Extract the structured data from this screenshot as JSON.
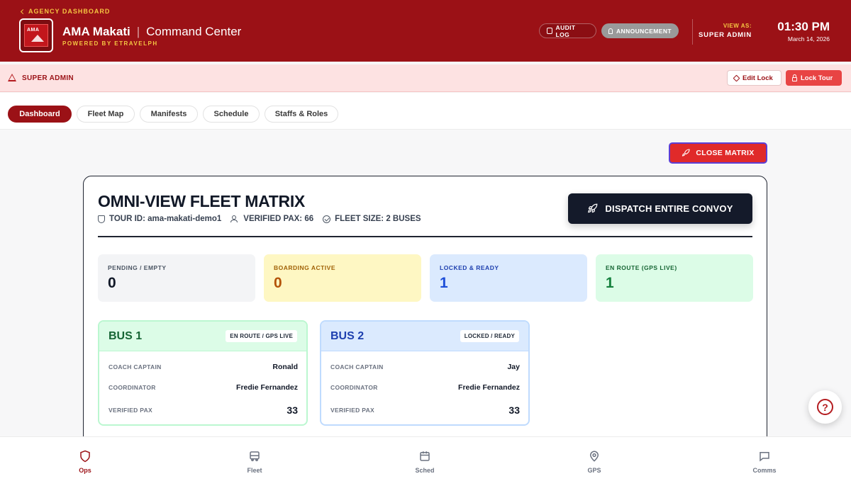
{
  "header": {
    "back_label": "AGENCY DASHBOARD",
    "brand": "AMA Makati",
    "separator": "|",
    "subtitle": "Command Center",
    "powered_by": "POWERED BY ETRAVELPH",
    "logo_text": "AMA",
    "audit_label": "AUDIT LOG",
    "announcement_label": "ANNOUNCEMENT",
    "view_as_label": "VIEW AS:",
    "view_as_value": "SUPER ADMIN",
    "time": "01:30 PM",
    "date": "March 14, 2026",
    "colors": {
      "bg": "#9b1116",
      "accent": "#f5c542"
    }
  },
  "admin_bar": {
    "label": "SUPER ADMIN",
    "edit_lock_label": "Edit Lock",
    "lock_tour_label": "Lock Tour"
  },
  "tabs": [
    {
      "label": "Dashboard",
      "active": true
    },
    {
      "label": "Fleet Map",
      "active": false
    },
    {
      "label": "Manifests",
      "active": false
    },
    {
      "label": "Schedule",
      "active": false
    },
    {
      "label": "Staffs & Roles",
      "active": false
    }
  ],
  "close_matrix_label": "CLOSE MATRIX",
  "matrix": {
    "title": "OMNI-VIEW FLEET MATRIX",
    "tour_id": "TOUR ID: ama-makati-demo1",
    "verified_pax": "VERIFIED PAX: 66",
    "fleet_size": "FLEET SIZE: 2 BUSES",
    "dispatch_label": "DISPATCH ENTIRE CONVOY",
    "stats": [
      {
        "label": "PENDING / EMPTY",
        "value": "0"
      },
      {
        "label": "BOARDING ACTIVE",
        "value": "0"
      },
      {
        "label": "LOCKED & READY",
        "value": "1"
      },
      {
        "label": "EN ROUTE (GPS LIVE)",
        "value": "1"
      }
    ],
    "buses": [
      {
        "name": "BUS 1",
        "status": "EN ROUTE / GPS LIVE",
        "rows": [
          {
            "key": "COACH CAPTAIN",
            "value": "Ronald"
          },
          {
            "key": "COORDINATOR",
            "value": "Fredie Fernandez"
          },
          {
            "key": "VERIFIED PAX",
            "value": "33"
          }
        ]
      },
      {
        "name": "BUS 2",
        "status": "LOCKED / READY",
        "rows": [
          {
            "key": "COACH CAPTAIN",
            "value": "Jay"
          },
          {
            "key": "COORDINATOR",
            "value": "Fredie Fernandez"
          },
          {
            "key": "VERIFIED PAX",
            "value": "33"
          }
        ]
      }
    ]
  },
  "help_glyph": "?",
  "bottom_nav": [
    {
      "label": "Ops",
      "icon": "shield-icon",
      "active": true
    },
    {
      "label": "Fleet",
      "icon": "bus-icon",
      "active": false
    },
    {
      "label": "Sched",
      "icon": "calendar-icon",
      "active": false
    },
    {
      "label": "GPS",
      "icon": "map-pin-icon",
      "active": false
    },
    {
      "label": "Comms",
      "icon": "chat-icon",
      "active": false
    }
  ]
}
